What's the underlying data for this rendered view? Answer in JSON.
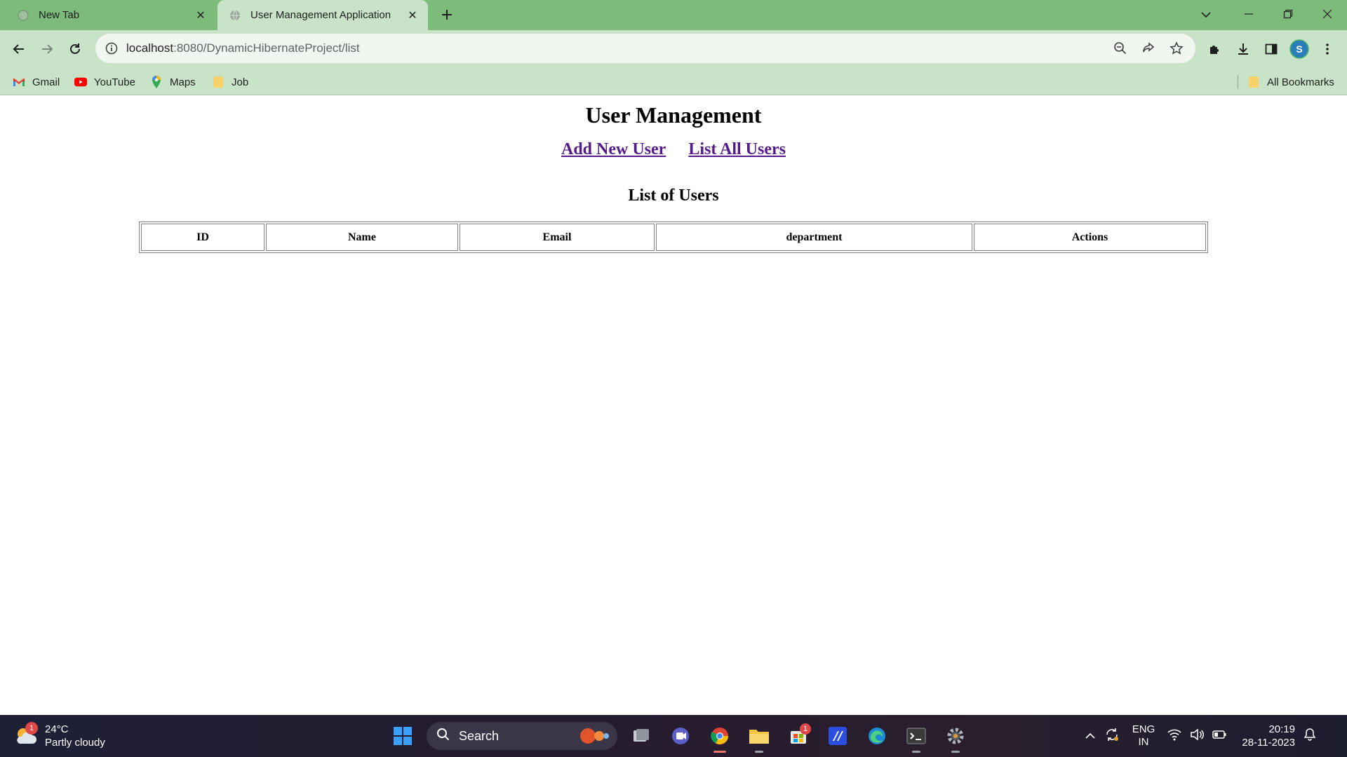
{
  "browser": {
    "tabs": [
      {
        "title": "New Tab",
        "active": false
      },
      {
        "title": "User Management Application",
        "active": true
      }
    ],
    "url_host": "localhost",
    "url_path": ":8080/DynamicHibernateProject/list",
    "bookmarks": [
      {
        "label": "Gmail",
        "icon": "gmail-icon"
      },
      {
        "label": "YouTube",
        "icon": "youtube-icon"
      },
      {
        "label": "Maps",
        "icon": "maps-icon"
      },
      {
        "label": "Job",
        "icon": "folder-icon"
      }
    ],
    "all_bookmarks_label": "All Bookmarks",
    "profile_initial": "S"
  },
  "page": {
    "title": "User Management",
    "links": {
      "add_user": "Add New User",
      "list_users": "List All Users"
    },
    "table_caption": "List of Users",
    "columns": [
      "ID",
      "Name",
      "Email",
      "department",
      "Actions"
    ],
    "rows": []
  },
  "taskbar": {
    "weather_badge": "1",
    "temperature": "24°C",
    "weather_desc": "Partly cloudy",
    "search_label": "Search",
    "store_badge": "1",
    "lang_top": "ENG",
    "lang_bottom": "IN",
    "time": "20:19",
    "date": "28-11-2023"
  },
  "colors": {
    "tabstrip": "#7cbb7c",
    "toolbar": "#c9e3c9",
    "visited_link": "#551a8b"
  }
}
